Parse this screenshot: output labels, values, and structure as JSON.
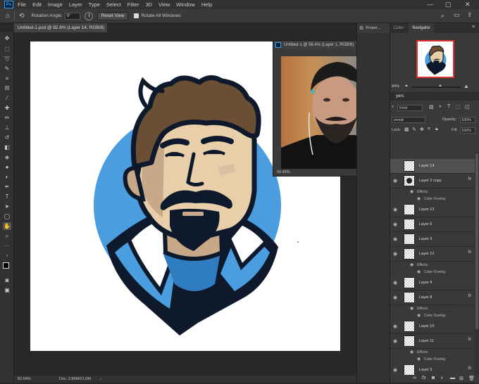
{
  "menubar": {
    "app_icon": "Ps",
    "items": [
      "File",
      "Edit",
      "Image",
      "Layer",
      "Type",
      "Select",
      "Filter",
      "3D",
      "View",
      "Window",
      "Help"
    ],
    "controls": [
      "—",
      "▢",
      "✕"
    ]
  },
  "options": {
    "rotation_label": "Rotation Angle:",
    "rotation_value": "0°",
    "reset_view": "Reset View",
    "rotate_all": "Rotate All Windows"
  },
  "document": {
    "tab_title": "Untitled-1.psd @ 82.6% (Layer 14, RGB/8) *",
    "status_zoom": "82.64%",
    "status_doc": "Doc: 2.86M/21.0M"
  },
  "navigator_window": {
    "title": "Untitled-1 @ 56.4% (Layer 1, RGB/8)",
    "zoom": "56.45%"
  },
  "panels": {
    "properties_tab": "Proper...",
    "color_tab": "Color",
    "navigator_tab": "Navigator",
    "nav_zoom": "84%",
    "layers_tab": "yers",
    "filter_kind": "Kind",
    "blend_mode": "ormal",
    "opacity_label": "Opacity:",
    "opacity_value": "100%",
    "lock_label": "Lock:",
    "fill_label": "Fill:",
    "fill_value": "100%"
  },
  "layers": [
    {
      "name": "Layer 14",
      "selected": true,
      "fx": false,
      "has_effect": false
    },
    {
      "name": "Layer 2 copy",
      "selected": false,
      "fx": true,
      "has_effect": true
    },
    {
      "name": "Layer 13",
      "selected": false,
      "fx": false,
      "has_effect": false
    },
    {
      "name": "Layer 6",
      "selected": false,
      "fx": false,
      "has_effect": false
    },
    {
      "name": "Layer 9",
      "selected": false,
      "fx": false,
      "has_effect": false
    },
    {
      "name": "Layer 12",
      "selected": false,
      "fx": true,
      "has_effect": true
    },
    {
      "name": "Layer 4",
      "selected": false,
      "fx": false,
      "has_effect": false
    },
    {
      "name": "Layer 8",
      "selected": false,
      "fx": true,
      "has_effect": true
    },
    {
      "name": "Layer 10",
      "selected": false,
      "fx": false,
      "has_effect": false
    },
    {
      "name": "Layer 11",
      "selected": false,
      "fx": true,
      "has_effect": true
    },
    {
      "name": "Layer 3",
      "selected": false,
      "fx": true,
      "has_effect": true
    }
  ],
  "effects_label": "Effects",
  "color_overlay_label": "Color Overlay",
  "fx_label": "fx",
  "colors": {
    "canvas_bg": "#ffffff",
    "circle_blue": "#4a9ee0",
    "outline": "#0e1a2b",
    "skin": "#e9cfa9",
    "skin_shadow": "#c7a98a",
    "hair": "#6a4f35",
    "panel_bg": "#393939",
    "selected_row": "#505050"
  }
}
